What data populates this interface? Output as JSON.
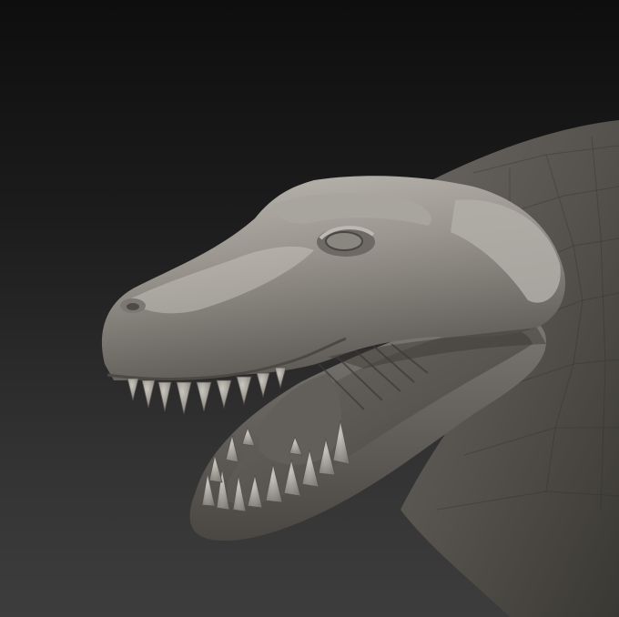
{
  "scene": {
    "subject": "dinosaur-head-sculpt",
    "background": {
      "top": "#0e0e0e",
      "bottom": "#3d3d3d"
    },
    "material": {
      "base": "#8f8b85",
      "highlight": "#b8b4ae",
      "shadow": "#3a3834",
      "mouth_interior": "#55524d"
    },
    "teeth": {
      "upper_count": 9,
      "lower_count": 13
    }
  }
}
